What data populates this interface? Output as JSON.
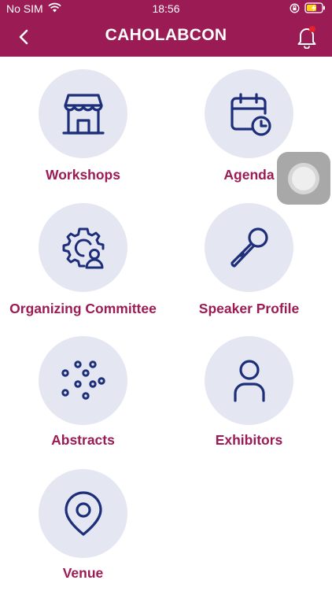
{
  "status_bar": {
    "carrier": "No SIM",
    "time": "18:56"
  },
  "header": {
    "title": "CAHOLABCON",
    "back_icon": "chevron-left-icon",
    "bell_icon": "bell-icon"
  },
  "colors": {
    "brand": "#9b1b54",
    "icon": "#1d2f7a",
    "circle_bg": "#e4e7f1",
    "badge": "#e8202a"
  },
  "menu": {
    "workshops": {
      "label": "Workshops",
      "icon": "storefront-icon"
    },
    "agenda": {
      "label": "Agenda",
      "icon": "calendar-clock-icon"
    },
    "committee": {
      "label": "Organizing Committee",
      "icon": "gear-user-icon"
    },
    "speaker": {
      "label": "Speaker Profile",
      "icon": "microphone-icon"
    },
    "abstracts": {
      "label": "Abstracts",
      "icon": "dots-icon"
    },
    "exhibitors": {
      "label": "Exhibitors",
      "icon": "user-icon"
    },
    "venue": {
      "label": "Venue",
      "icon": "location-pin-icon"
    }
  }
}
